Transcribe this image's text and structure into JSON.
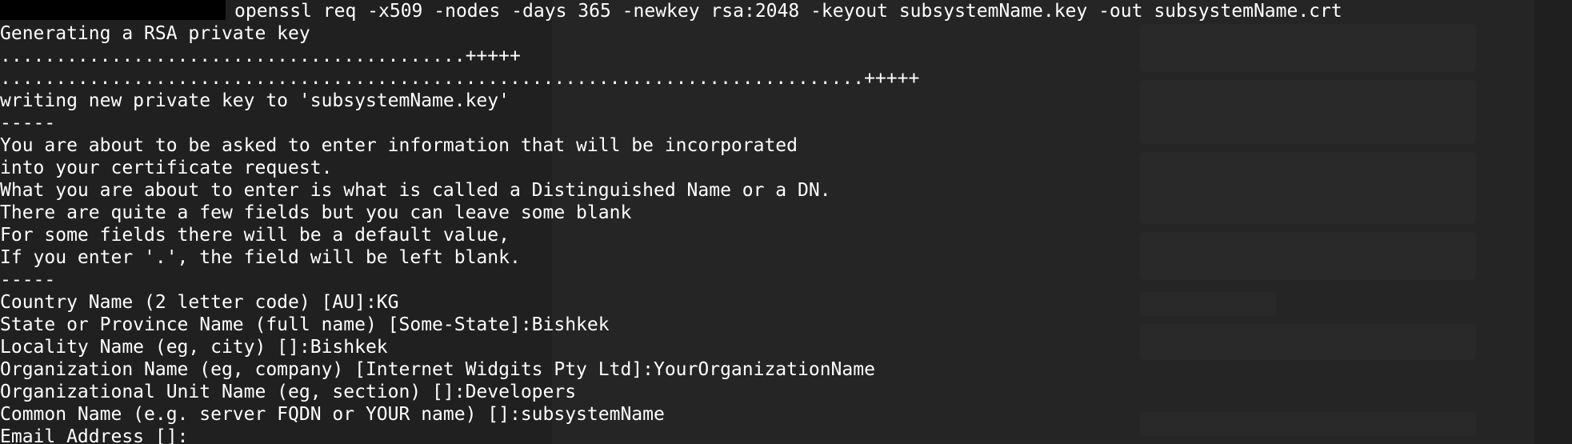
{
  "terminal": {
    "command": "openssl req -x509 -nodes -days 365 -newkey rsa:2048 -keyout subsystemName.key -out subsystemName.crt",
    "lines": [
      "Generating a RSA private key",
      "..........................................+++++",
      "..............................................................................+++++",
      "writing new private key to 'subsystemName.key'",
      "-----",
      "You are about to be asked to enter information that will be incorporated",
      "into your certificate request.",
      "What you are about to enter is what is called a Distinguished Name or a DN.",
      "There are quite a few fields but you can leave some blank",
      "For some fields there will be a default value,",
      "If you enter '.', the field will be left blank.",
      "-----",
      "Country Name (2 letter code) [AU]:KG",
      "State or Province Name (full name) [Some-State]:Bishkek",
      "Locality Name (eg, city) []:Bishkek",
      "Organization Name (eg, company) [Internet Widgits Pty Ltd]:YourOrganizationName",
      "Organizational Unit Name (eg, section) []:Developers",
      "Common Name (e.g. server FQDN or YOUR name) []:subsystemName",
      "Email Address []:"
    ]
  },
  "colors": {
    "text": "#ffffff",
    "terminal_bg": "#181818",
    "redaction": "#000000"
  }
}
